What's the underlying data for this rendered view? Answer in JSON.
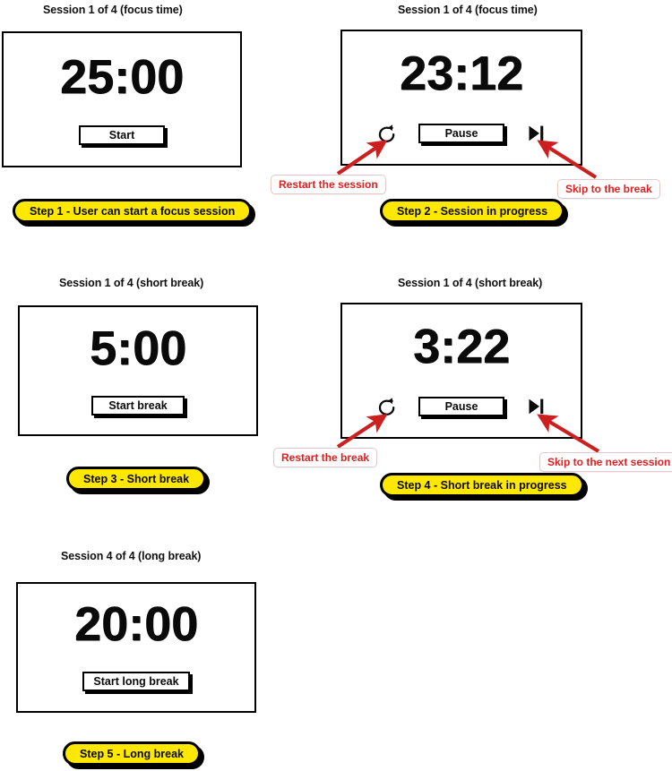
{
  "app": {
    "title": "Pomodoro Timer Wireframe",
    "colors": {
      "badge_yellow": "#ffe800",
      "annotation_red": "#e02020",
      "arrow_red": "#cc2020",
      "frame_black": "#000000",
      "text_black": "#0a0a0a"
    }
  },
  "panels": [
    {
      "id": "focus-idle",
      "caption": "Session 1 of 4 (focus time)",
      "timer": "25:00",
      "buttons": {
        "primary": "Start"
      },
      "icons": [],
      "step_badge": "Step 1 - User can start a focus session"
    },
    {
      "id": "focus-running",
      "caption": "Session 1 of 4 (focus time)",
      "timer": "23:12",
      "buttons": {
        "primary": "Pause"
      },
      "icons": [
        "restart-icon",
        "skip-forward-icon"
      ],
      "step_badge": "Step 2 - Session in progress"
    },
    {
      "id": "short-break-idle",
      "caption": "Session 1 of 4 (short break)",
      "timer": "5:00",
      "buttons": {
        "primary": "Start break"
      },
      "icons": [],
      "step_badge": "Step 3 - Short break"
    },
    {
      "id": "short-break-running",
      "caption": "Session 1 of 4 (short break)",
      "timer": "3:22",
      "buttons": {
        "primary": "Pause"
      },
      "icons": [
        "restart-icon",
        "skip-forward-icon"
      ],
      "step_badge": "Step 4 - Short break in progress"
    },
    {
      "id": "long-break-idle",
      "caption": "Session 4 of 4 (long break)",
      "timer": "20:00",
      "buttons": {
        "primary": "Start long break"
      },
      "icons": [],
      "step_badge": "Step 5 - Long break"
    }
  ],
  "annotations": [
    {
      "id": "restart-session",
      "label": "Restart the session",
      "points_to": "restart-icon"
    },
    {
      "id": "skip-break",
      "label": "Skip to the break",
      "points_to": "skip-forward-icon"
    },
    {
      "id": "restart-break",
      "label": "Restart the break",
      "points_to": "restart-icon"
    },
    {
      "id": "skip-next",
      "label": "Skip to the next session",
      "points_to": "skip-forward-icon"
    }
  ]
}
